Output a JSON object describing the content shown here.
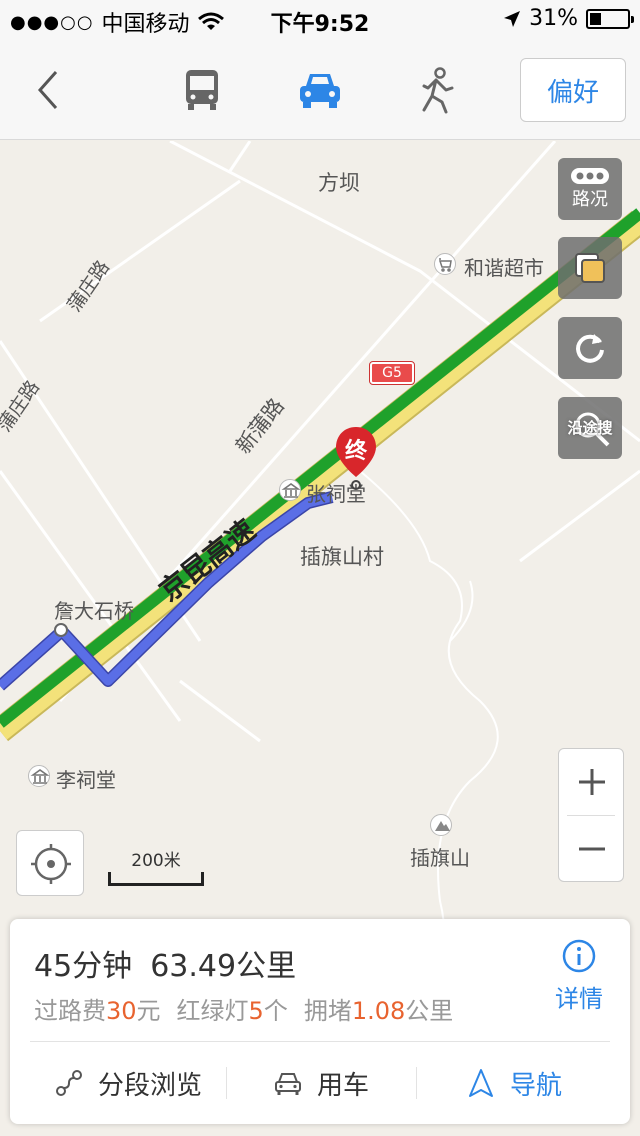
{
  "status_bar": {
    "signal": "●●●○○",
    "carrier": "中国移动",
    "time": "下午9:52",
    "battery": "31%",
    "battery_level": 0.31
  },
  "nav": {
    "modes": [
      "bus-icon",
      "car-icon",
      "walk-icon"
    ],
    "active_mode": "car",
    "preference_label": "偏好"
  },
  "map": {
    "labels": {
      "fangba": "方坝",
      "hexie_market": "和谐超市",
      "xinpu_road": "新蒲路",
      "highway_name": "京昆高速",
      "highway_code": "G5",
      "destination_marker": "终",
      "zhang_ancestral_hall": "张祠堂",
      "chaqishan_village": "插旗山村",
      "zhanda_bridge": "詹大石桥",
      "li_ancestral_hall": "李祠堂",
      "chaqishan": "插旗山",
      "road_left1": "蒲庄路",
      "road_left2": "蒲庄路"
    },
    "controls": {
      "traffic": "路况",
      "along_search": "沿途搜"
    },
    "scale": "200米",
    "colors": {
      "route": "#5a6ee6",
      "highway_green": "#1fa12b",
      "highway_yellow": "#f3e27a",
      "accent": "#2d86e6",
      "marker": "#d8262b"
    }
  },
  "route_card": {
    "duration": "45分钟",
    "distance": "63.49公里",
    "toll_label": "过路费",
    "toll_value": "30",
    "toll_unit": "元",
    "lights_label": "红绿灯",
    "lights_value": "5",
    "lights_unit": "个",
    "congestion_label": "拥堵",
    "congestion_value": "1.08",
    "congestion_unit": "公里",
    "details_label": "详情",
    "actions": {
      "segments": "分段浏览",
      "car": "用车",
      "navigate": "导航"
    }
  }
}
